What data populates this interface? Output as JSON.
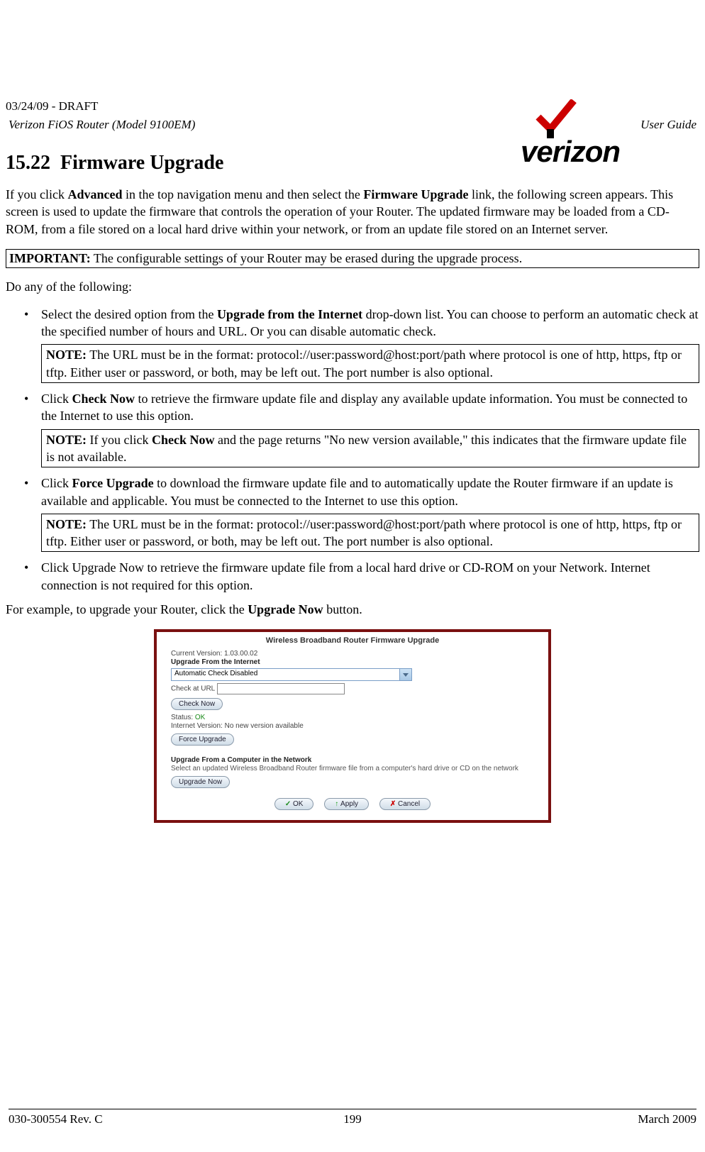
{
  "header": {
    "draft": "03/24/09 - DRAFT",
    "product": "Verizon FiOS Router (Model 9100EM)",
    "doctype": "User Guide",
    "logo_text": "verizon"
  },
  "section": {
    "number": "15.22",
    "title": "Firmware Upgrade"
  },
  "intro": {
    "p1_a": "If you click ",
    "p1_b": "Advanced",
    "p1_c": " in the top navigation menu and then select the ",
    "p1_d": "Firmware Upgrade",
    "p1_e": " link, the following screen appears. This screen is used to update the firmware that controls the operation of your Router. The updated firmware may be loaded from a CD-ROM, from a file stored on a local hard drive within your network, or from an update file stored on an Internet server."
  },
  "important": {
    "label": "IMPORTANT:",
    "text": " The configurable settings of your Router may be erased during the upgrade process."
  },
  "do_any": "Do any of the following:",
  "bullets": {
    "b1_a": "Select the desired option from the ",
    "b1_b": "Upgrade from the Internet",
    "b1_c": " drop-down list. You can choose to perform an automatic check at the specified number of hours and URL. Or you can disable automatic check.",
    "note1_label": "NOTE:",
    "note1_text": " The URL must be in the format: protocol://user:password@host:port/path where protocol is one of http, https, ftp or tftp. Either user or password, or both, may be left out. The port number is also optional.",
    "b2_a": "Click ",
    "b2_b": "Check Now",
    "b2_c": " to retrieve the firmware update file and display any available update information. You must be connected to the Internet to use this option.",
    "note2_label": "NOTE:",
    "note2_a": " If you click ",
    "note2_b": "Check Now",
    "note2_c": " and the page returns \"No new version available,\" this indicates that the firmware update file is not available.",
    "b3_a": "Click ",
    "b3_b": "Force Upgrade",
    "b3_c": " to download the firmware update file and to automatically update the Router firmware if an update is available and applicable. You must be connected to the Internet to use this option.",
    "note3_label": "NOTE:",
    "note3_text": " The URL must be in the format: protocol://user:password@host:port/path where protocol is one of http, https, ftp or tftp. Either user or password, or both, may be left out. The port number is also optional.",
    "b4": "Click Upgrade Now to retrieve the firmware update file from a local hard drive or CD-ROM on your Network. Internet connection is not required for this option."
  },
  "example": {
    "a": "For example, to upgrade your Router, click the ",
    "b": "Upgrade Now",
    "c": " button."
  },
  "router_ui": {
    "title": "Wireless Broadband Router Firmware Upgrade",
    "current_version_label": "Current Version: 1.03.00.02",
    "upgrade_internet_heading": "Upgrade From the Internet",
    "select_value": "Automatic Check Disabled",
    "check_url_label": "Check at URL",
    "check_now_btn": "Check Now",
    "status_label": "Status: ",
    "status_value": "OK",
    "internet_version": "Internet Version: No new version available",
    "force_upgrade_btn": "Force Upgrade",
    "upgrade_computer_heading": "Upgrade From a Computer in the Network",
    "upgrade_computer_desc": "Select an updated Wireless Broadband Router firmware file from a computer's hard drive or CD on the network",
    "upgrade_now_btn": "Upgrade Now",
    "ok_btn": "OK",
    "apply_btn": "Apply",
    "cancel_btn": "Cancel"
  },
  "footer": {
    "left": "030-300554 Rev. C",
    "center": "199",
    "right": "March 2009"
  }
}
